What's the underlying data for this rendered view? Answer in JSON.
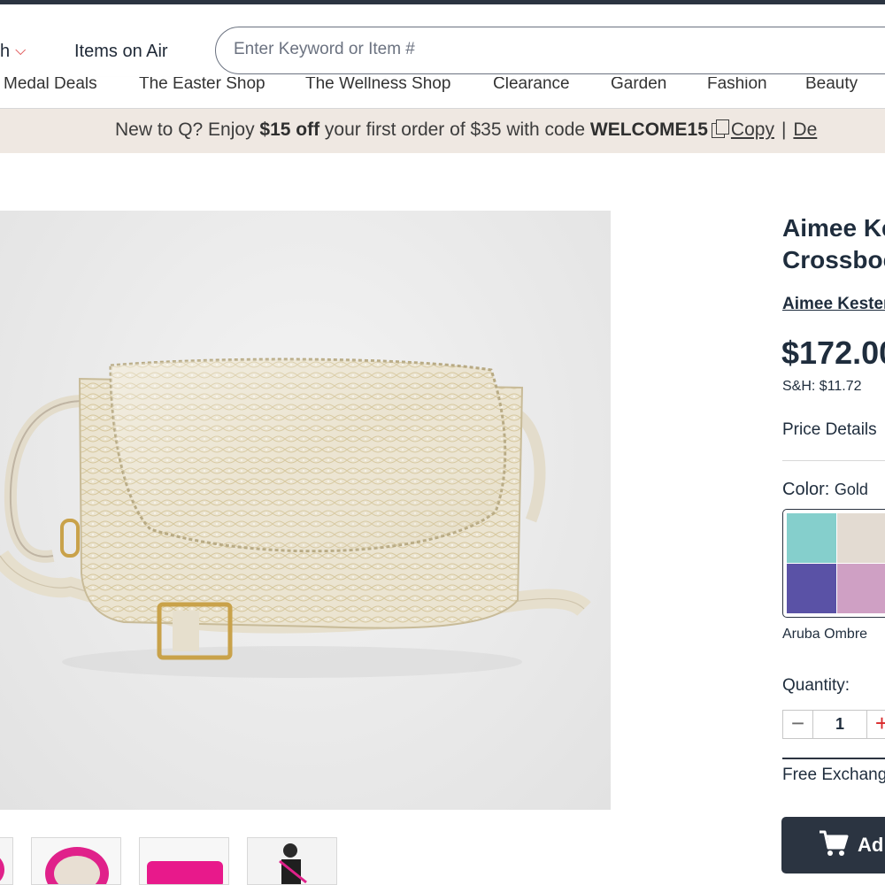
{
  "header": {
    "nav_partial_label": "h",
    "items_on_air": "Items on Air",
    "search_placeholder": "Enter Keyword or Item #"
  },
  "category_nav": [
    "Medal Deals",
    "The Easter Shop",
    "The Wellness Shop",
    "Clearance",
    "Garden",
    "Fashion",
    "Beauty"
  ],
  "promo": {
    "prefix": "New to Q? Enjoy ",
    "discount": "$15 off",
    "middle": " your first order of $35 with code ",
    "code": "WELCOME15",
    "copy_label": "Copy",
    "separator": "|",
    "details_partial": "De"
  },
  "product": {
    "title_line1": "Aimee Ke",
    "title_line2": "Crossboc",
    "brand": "Aimee Kester",
    "price": "$172.00",
    "sh": "S&H: $11.72",
    "price_details": "Price Details",
    "color_label": "Color:",
    "color_value": "Gold",
    "selected_swatch_name": "Aruba Ombre",
    "swatch_colors": [
      "#85cfcc",
      "#e3dbd2",
      "#5a52a6",
      "#cfa0c4"
    ],
    "quantity_label": "Quantity:",
    "quantity_value": "1",
    "free_exchange": "Free Exchang",
    "add_button": "Ad"
  },
  "colors": {
    "accent_red": "#d9292b",
    "navy": "#2b3441",
    "promo_bg": "#efe8e2"
  }
}
